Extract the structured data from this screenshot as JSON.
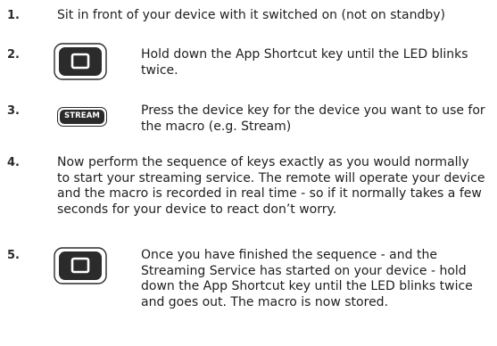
{
  "steps": [
    {
      "num": "1.",
      "text": "Sit in front of your device with it switched on (not on standby)"
    },
    {
      "num": "2.",
      "icon": "app-shortcut-key-icon",
      "text": "Hold down the App Shortcut key until the LED blinks twice."
    },
    {
      "num": "3.",
      "icon": "stream-key-icon",
      "key_label": "STREAM",
      "text": "Press the device key for the device you want to use for the macro (e.g. Stream)"
    },
    {
      "num": "4.",
      "text": "Now perform the sequence of keys exactly as you would normally to start your streaming service. The remote will operate your device and the macro is recorded in real time - so if it normally takes a few seconds for your device to react don’t worry."
    },
    {
      "num": "5.",
      "icon": "app-shortcut-key-icon",
      "text": "Once you have finished the sequence - and the Streaming Service has started on your device - hold down the App Shortcut key until the LED blinks twice and goes out. The macro is now stored."
    }
  ]
}
